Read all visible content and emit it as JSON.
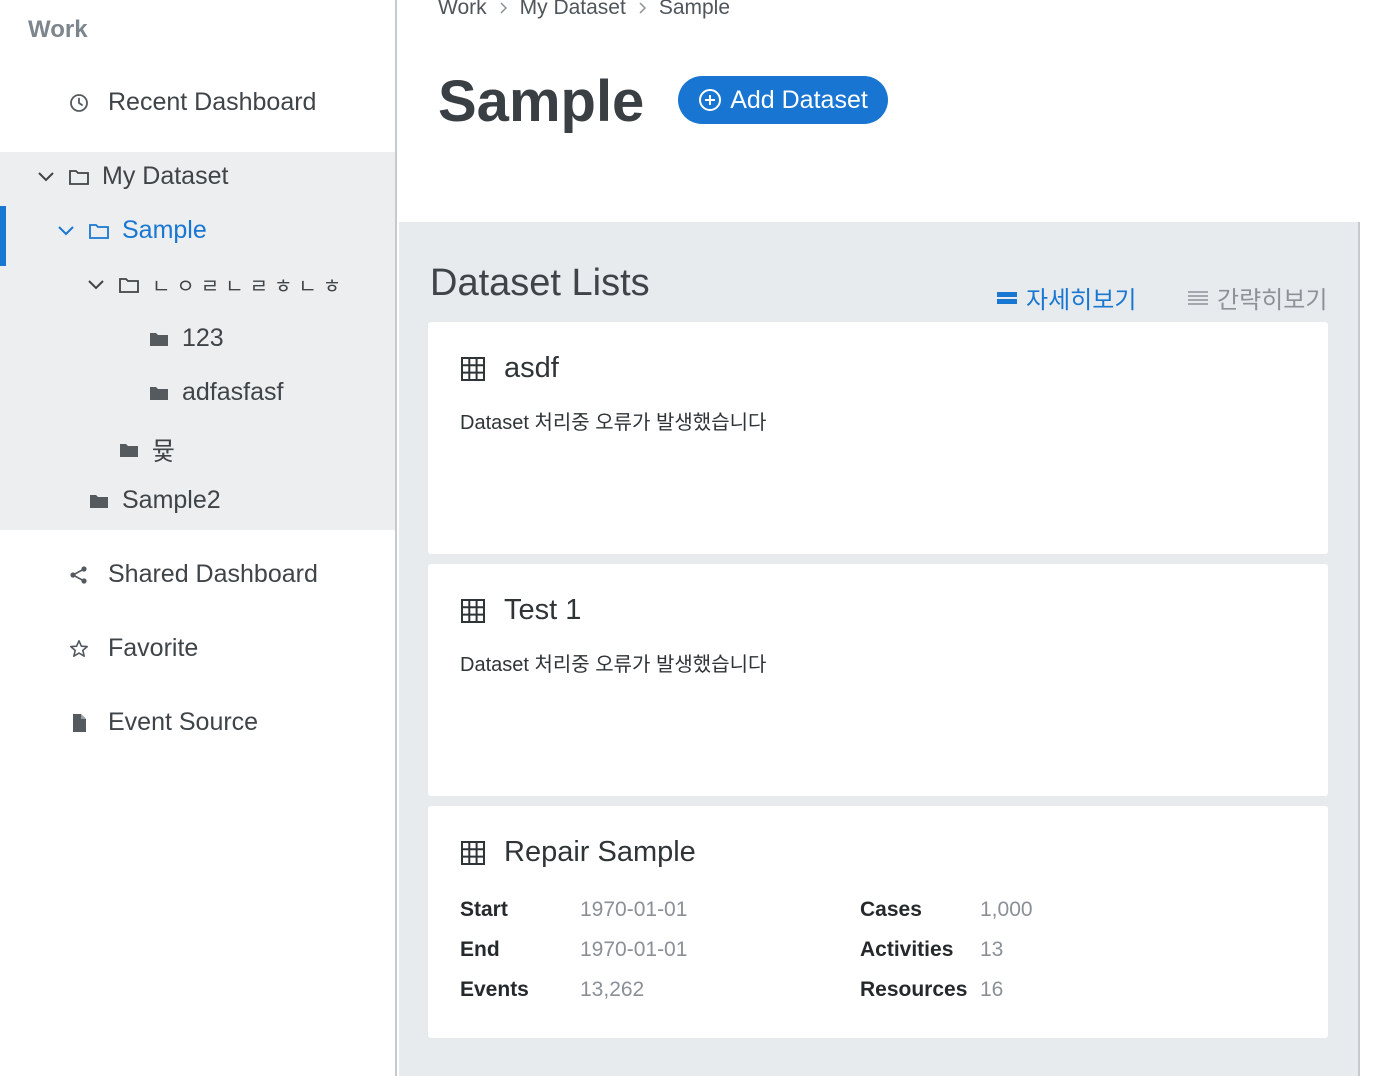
{
  "sidebar": {
    "heading": "Work",
    "recent_dashboard": "Recent Dashboard",
    "tree": {
      "my_dataset": "My Dataset",
      "sample": "Sample",
      "korean_folder": "ㄴㅇㄹㄴㄹㅎㄴㅎ",
      "folder_123": "123",
      "folder_adfasfasf": "adfasfasf",
      "folder_myuj": "뮻",
      "sample2": "Sample2"
    },
    "shared_dashboard": "Shared Dashboard",
    "favorite": "Favorite",
    "event_source": "Event Source"
  },
  "header": {
    "breadcrumb": [
      "Work",
      "My Dataset",
      "Sample"
    ],
    "title": "Sample",
    "add_button": "Add Dataset"
  },
  "main": {
    "section_title": "Dataset Lists",
    "view_detail": "자세히보기",
    "view_simple": "간략히보기",
    "cards": [
      {
        "name": "asdf",
        "message": "Dataset 처리중 오류가 발생했습니다"
      },
      {
        "name": "Test 1",
        "message": "Dataset 처리중 오류가 발생했습니다"
      },
      {
        "name": "Repair Sample",
        "stats": {
          "start_label": "Start",
          "start_value": "1970-01-01",
          "end_label": "End",
          "end_value": "1970-01-01",
          "events_label": "Events",
          "events_value": "13,262",
          "cases_label": "Cases",
          "cases_value": "1,000",
          "activities_label": "Activities",
          "activities_value": "13",
          "resources_label": "Resources",
          "resources_value": "16"
        }
      }
    ]
  },
  "colors": {
    "accent": "#1877d2",
    "panel_bg": "#e8ebee",
    "tree_bg": "#eceef0"
  },
  "icons": {
    "recent": "clock-icon",
    "folder_open": "folder-outline-icon",
    "folder_closed": "folder-filled-icon",
    "shared": "share-icon",
    "favorite": "star-icon",
    "event_source": "document-icon",
    "dataset": "table-grid-icon",
    "add": "plus-circle-icon"
  }
}
